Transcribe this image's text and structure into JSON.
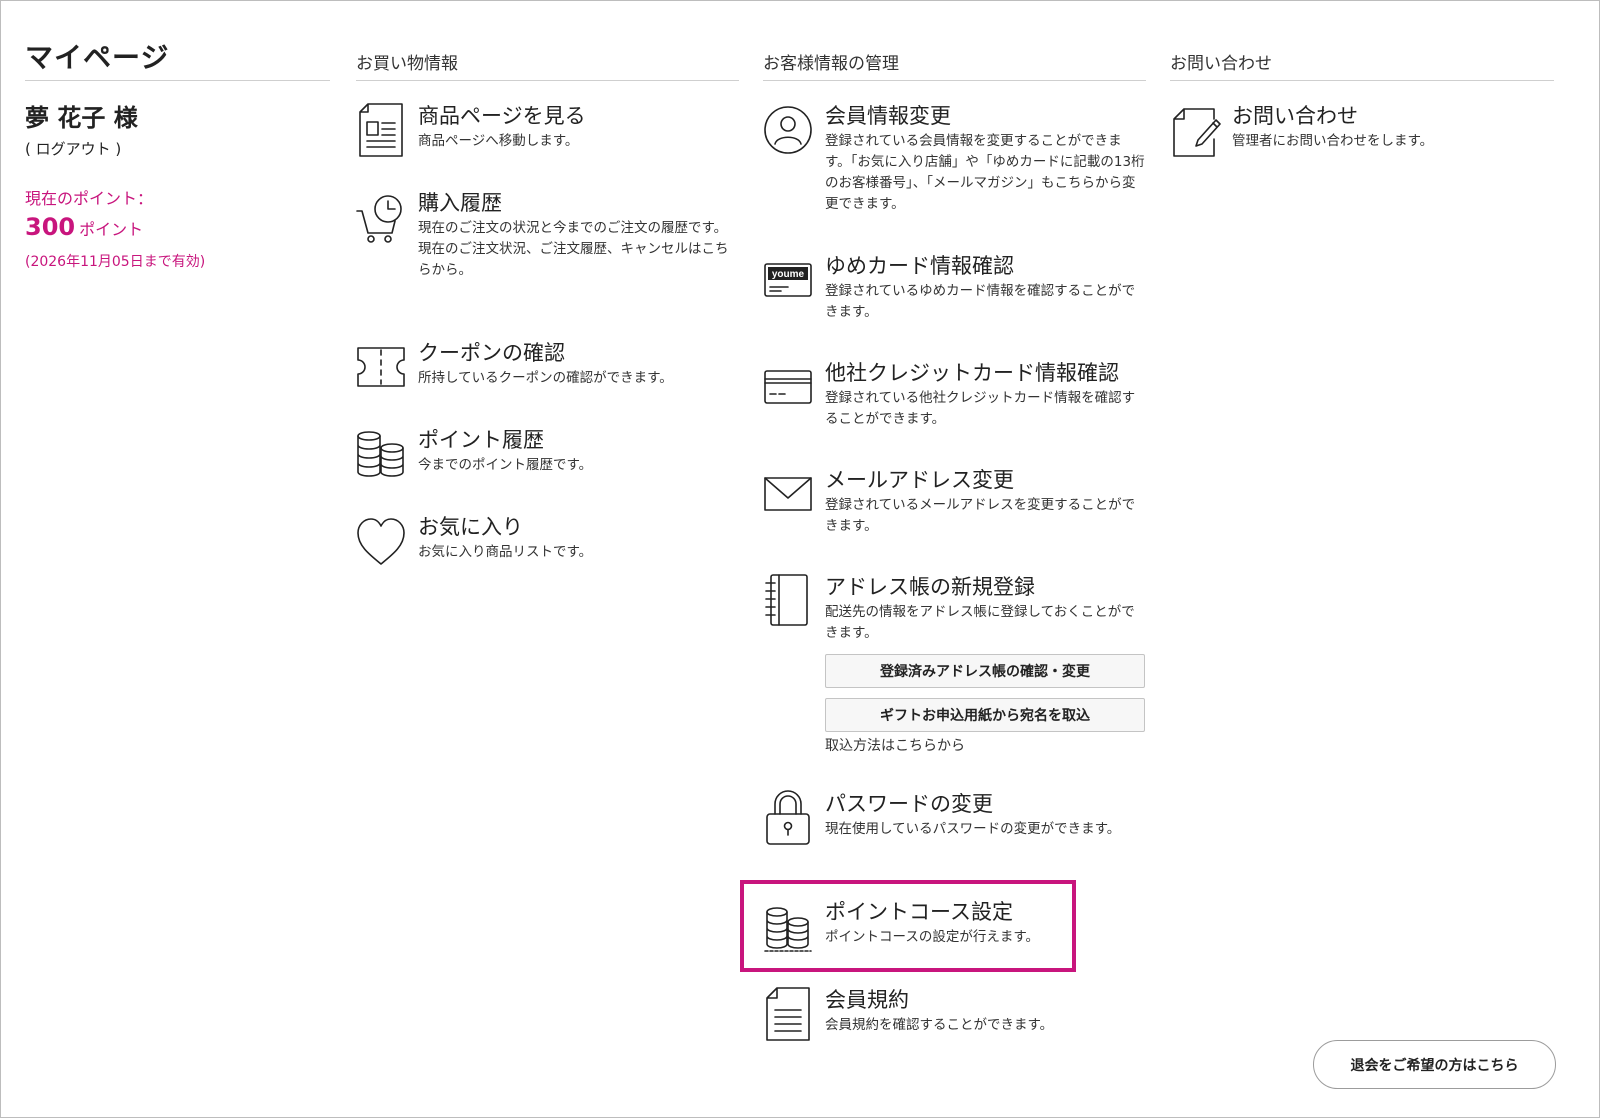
{
  "page_title": "マイページ",
  "user": {
    "name": "夢 花子 様",
    "logout_label": "( ログアウト )"
  },
  "points": {
    "label": "現在のポイント：",
    "value": "300",
    "unit": "ポイント",
    "expiry": "(2026年11月05日まで有効)"
  },
  "accent_color": "#c8157d",
  "shopping": {
    "header": "お買い物情報",
    "items": [
      {
        "title": "商品ページを見る",
        "desc": "商品ページへ移動します。",
        "icon": "document-icon"
      },
      {
        "title": "購入履歴",
        "desc": "現在のご注文の状況と今までのご注文の履歴です。",
        "desc2": "現在のご注文状況、ご注文履歴、キャンセルはこちらから。",
        "icon": "cart-clock-icon"
      },
      {
        "title": "クーポンの確認",
        "desc": "所持しているクーポンの確認ができます。",
        "icon": "ticket-icon"
      },
      {
        "title": "ポイント履歴",
        "desc": "今までのポイント履歴です。",
        "icon": "coins-icon"
      },
      {
        "title": "お気に入り",
        "desc": "お気に入り商品リストです。",
        "icon": "heart-icon"
      }
    ]
  },
  "account": {
    "header": "お客様情報の管理",
    "items": [
      {
        "title": "会員情報変更",
        "desc": "登録されている会員情報を変更することができます。「お気に入り店舗」や「ゆめカードに記載の13桁のお客様番号」、「メールマガジン」もこちらから変更できます。",
        "icon": "user-icon"
      },
      {
        "title": "ゆめカード情報確認",
        "desc": "登録されているゆめカード情報を確認することができます。",
        "icon": "youme-card-icon",
        "card_text": "youme"
      },
      {
        "title": "他社クレジットカード情報確認",
        "desc": "登録されている他社クレジットカード情報を確認することができます。",
        "icon": "credit-card-icon"
      },
      {
        "title": "メールアドレス変更",
        "desc": "登録されているメールアドレスを変更することができます。",
        "icon": "envelope-icon"
      },
      {
        "title": "アドレス帳の新規登録",
        "desc": "配送先の情報をアドレス帳に登録しておくことができます。",
        "icon": "address-book-icon"
      },
      {
        "title": "パスワードの変更",
        "desc": "現在使用しているパスワードの変更ができます。",
        "icon": "lock-icon"
      },
      {
        "title": "ポイントコース設定",
        "desc": "ポイントコースの設定が行えます。",
        "icon": "coins-icon"
      },
      {
        "title": "会員規約",
        "desc": "会員規約を確認することができます。",
        "icon": "document-icon"
      }
    ],
    "address_buttons": [
      "登録済みアドレス帳の確認・変更",
      "ギフトお申込用紙から宛名を取込"
    ],
    "import_note": "取込方法はこちらから"
  },
  "contact": {
    "header": "お問い合わせ",
    "items": [
      {
        "title": "お問い合わせ",
        "desc": "管理者にお問い合わせをします。",
        "icon": "edit-icon"
      }
    ]
  },
  "withdraw_label": "退会をご希望の方はこちら"
}
